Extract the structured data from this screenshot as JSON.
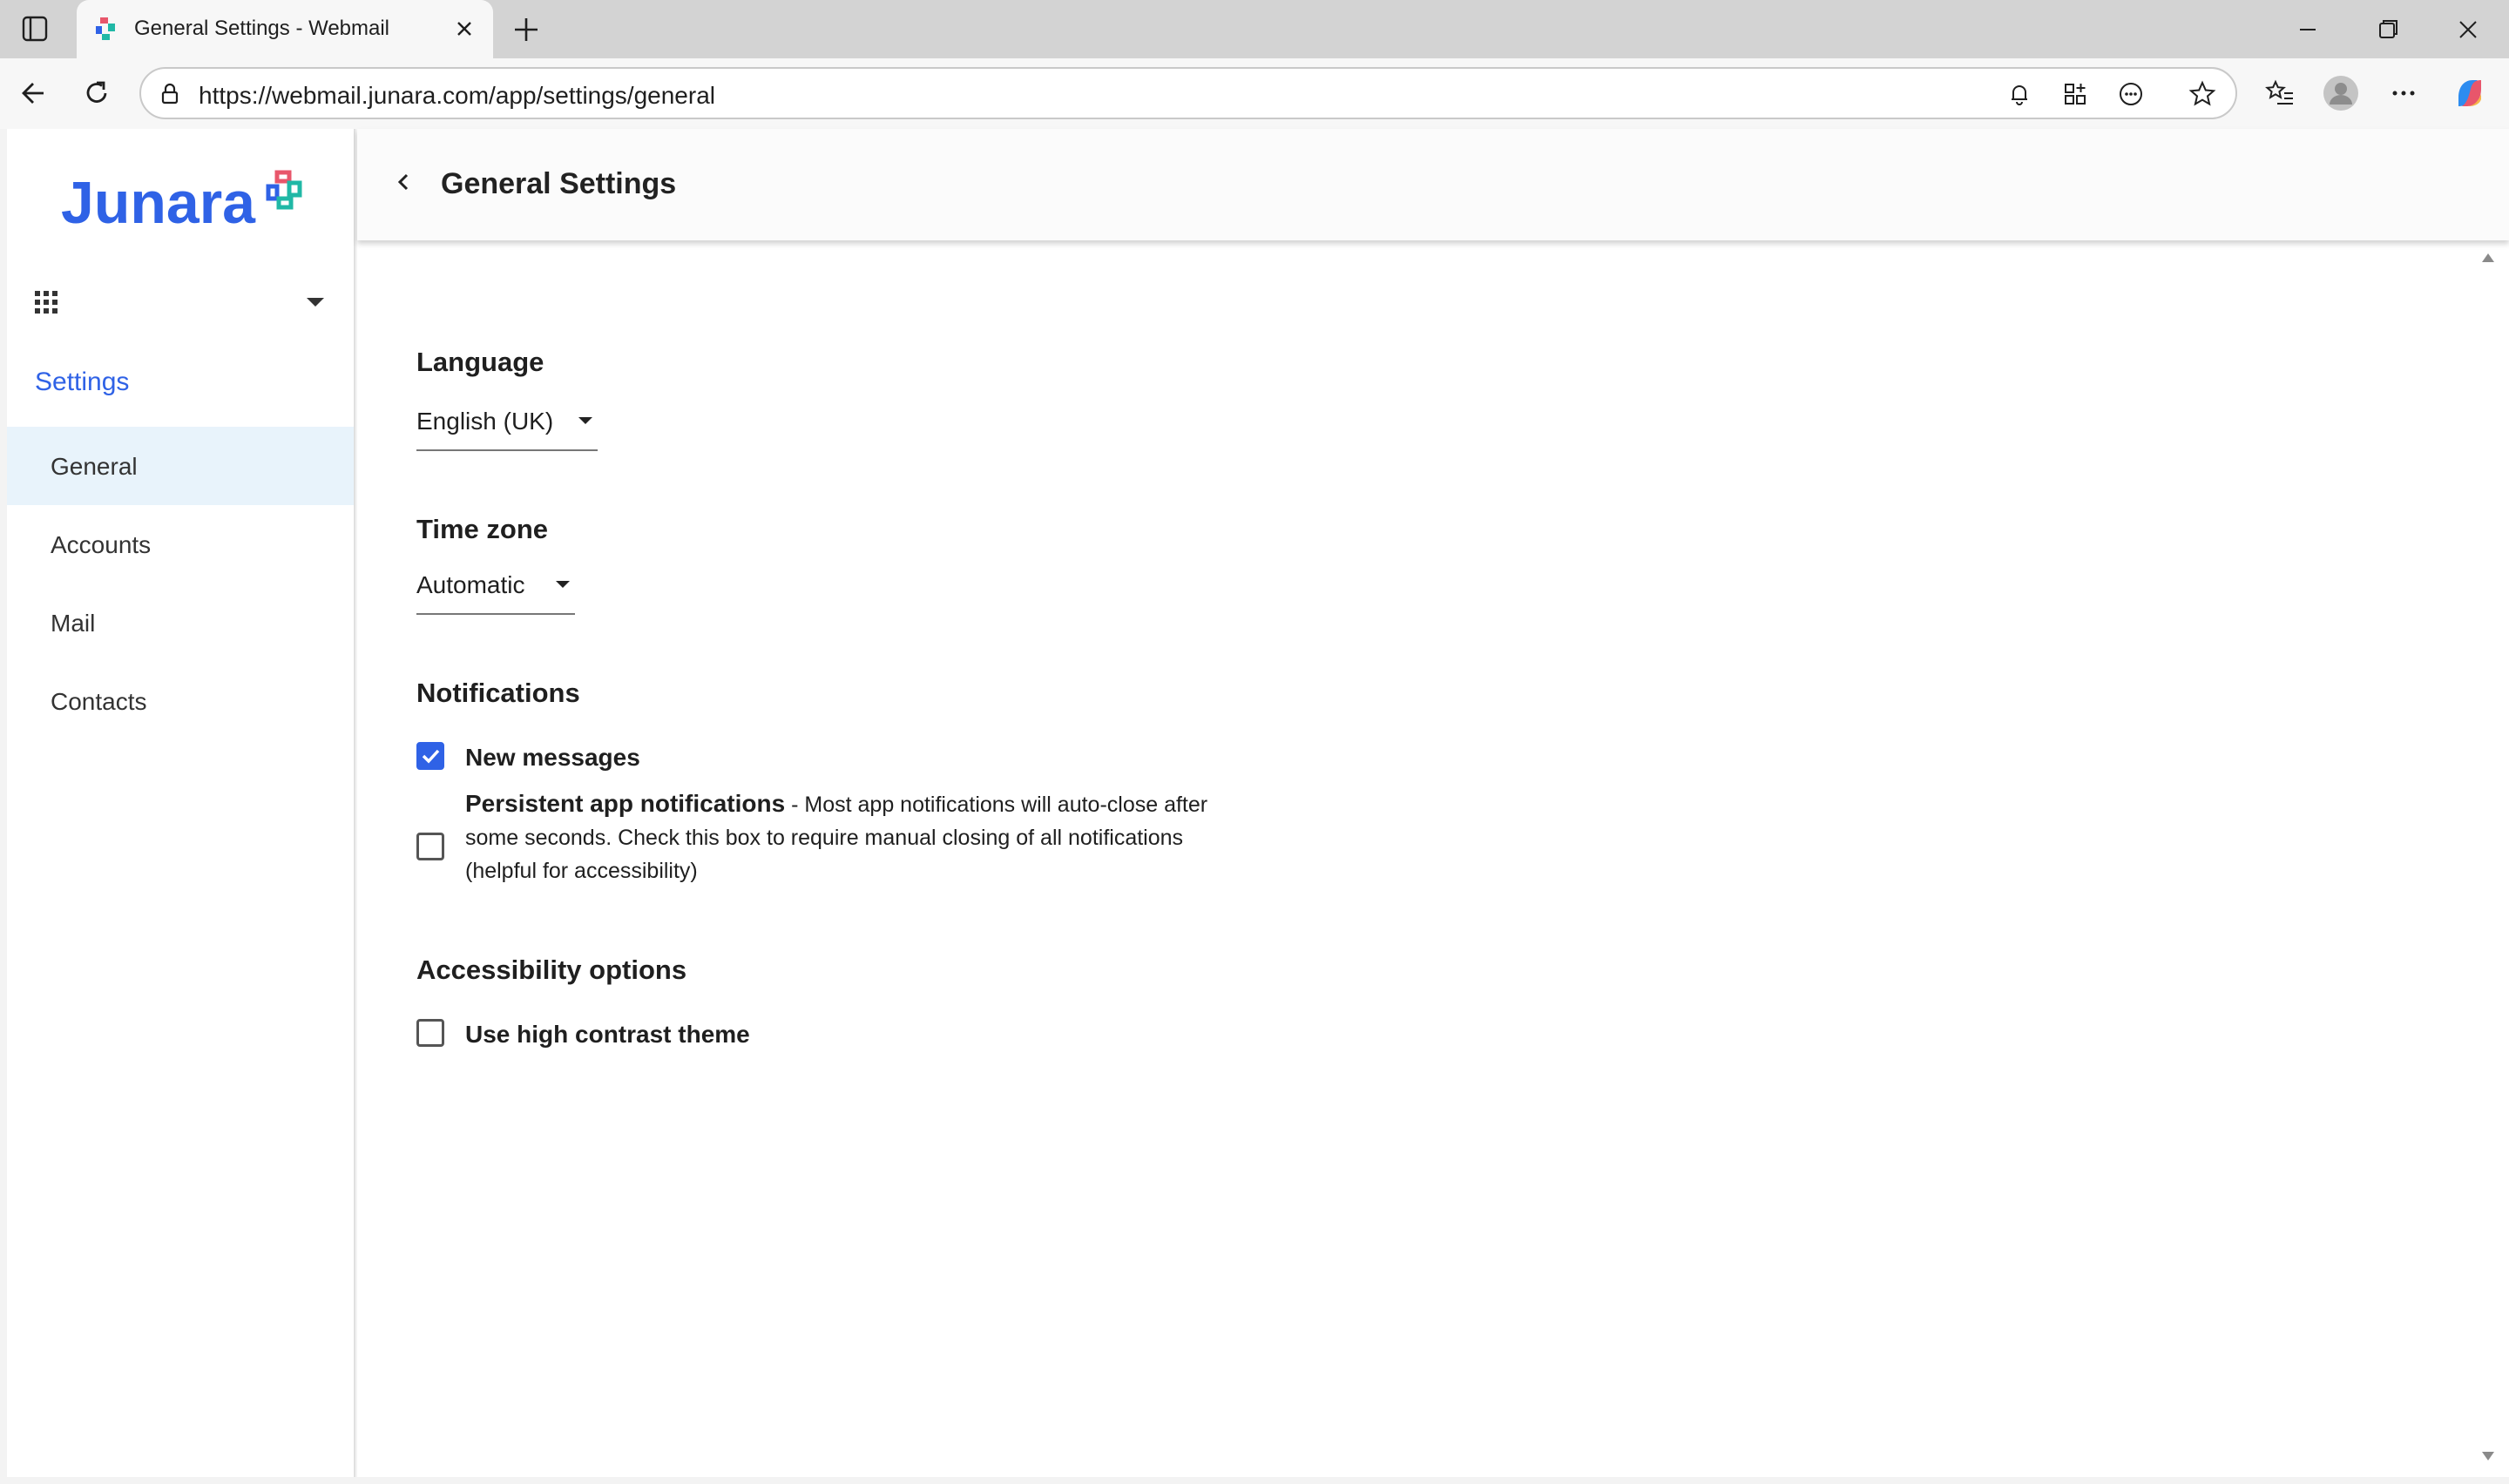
{
  "browser": {
    "tab_title": "General Settings - Webmail",
    "url": "https://webmail.junara.com/app/settings/general"
  },
  "brand": {
    "name": "Junara",
    "accent_color": "#2f62e6",
    "logo_colors": [
      "#2f62e6",
      "#e8566b",
      "#20b8a6"
    ]
  },
  "sidebar": {
    "heading": "Settings",
    "items": [
      {
        "label": "General",
        "active": true
      },
      {
        "label": "Accounts",
        "active": false
      },
      {
        "label": "Mail",
        "active": false
      },
      {
        "label": "Contacts",
        "active": false
      }
    ]
  },
  "header": {
    "title": "General Settings"
  },
  "settings": {
    "language": {
      "title": "Language",
      "value": "English (UK)"
    },
    "timezone": {
      "title": "Time zone",
      "value": "Automatic"
    },
    "notifications": {
      "title": "Notifications",
      "new_messages": {
        "label": "New messages",
        "checked": true
      },
      "persistent": {
        "label": "Persistent app notifications",
        "description": " - Most app notifications will auto-close after some seconds. Check this box to require manual closing of all notifications (helpful for accessibility)",
        "checked": false
      }
    },
    "accessibility": {
      "title": "Accessibility options",
      "high_contrast": {
        "label": "Use high contrast theme",
        "checked": false
      }
    }
  },
  "icons": {
    "tab_actions": "tab-actions-icon",
    "favicon": "junara-favicon",
    "close": "close-icon",
    "new_tab": "plus-icon",
    "back": "arrow-left-icon",
    "reload": "reload-icon",
    "lock": "site-info-icon",
    "notifications": "bell-icon",
    "extensions": "apps-add-icon",
    "more_options": "ellipsis-circle-icon",
    "favorite": "star-icon",
    "favorites": "favorites-list-icon",
    "profile": "avatar-icon",
    "menu": "more-icon",
    "copilot": "copilot-icon",
    "apps": "app-grid-icon"
  }
}
